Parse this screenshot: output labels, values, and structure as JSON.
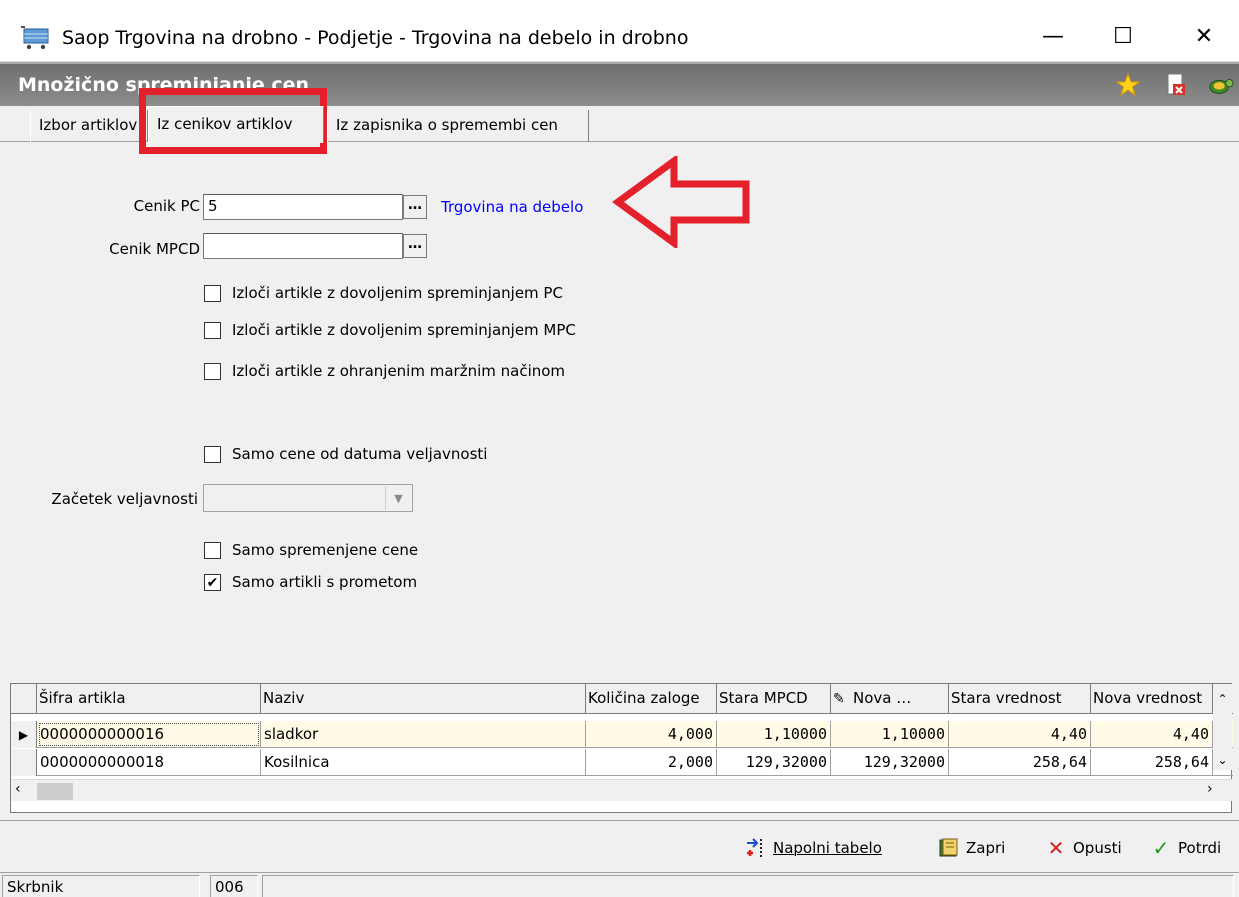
{
  "window": {
    "title": "Saop Trgovina na drobno - Podjetje - Trgovina na debelo in drobno",
    "minimize": "—",
    "maximize": "☐",
    "close": "✕"
  },
  "header": {
    "title": "Množično spreminjanje cen",
    "icons": [
      "star-icon",
      "document-delete-icon",
      "turtle-icon"
    ]
  },
  "tabs": [
    {
      "label": "Izbor artiklov",
      "active": false
    },
    {
      "label": "Iz cenikov artiklov",
      "active": true
    },
    {
      "label": "Iz zapisnika o spremembi cen",
      "active": false
    }
  ],
  "form": {
    "cenik_pc_label": "Cenik PC",
    "cenik_pc_value": "5",
    "cenik_pc_button": "…",
    "cenik_pc_desc": "Trgovina na debelo",
    "cenik_mpcd_label": "Cenik MPCD",
    "cenik_mpcd_value": "",
    "cenik_mpcd_button": "…",
    "chk_izloci_pc": "Izloči artikle z dovoljenim spreminjanjem PC",
    "chk_izloci_mpc": "Izloči artikle z dovoljenim spreminjanjem MPC",
    "chk_izloci_marzni": "Izloči artikle z ohranjenim maržnim načinom",
    "chk_samo_cene_datum": "Samo cene od datuma veljavnosti",
    "zacetek_label": "Začetek veljavnosti",
    "zacetek_value": "",
    "chk_samo_spremenjene": "Samo spremenjene cene",
    "chk_samo_promet": "Samo artikli s prometom",
    "checked": {
      "izloci_pc": false,
      "izloci_mpc": false,
      "izloci_marzni": false,
      "samo_cene_datum": false,
      "samo_spremenjene": false,
      "samo_promet": true
    }
  },
  "grid": {
    "columns": [
      "Šifra artikla",
      "Naziv",
      "Količina zaloge",
      "Stara MPCD",
      "Nova …",
      "Stara vrednost",
      "Nova vrednost"
    ],
    "rows": [
      {
        "sifra": "0000000000016",
        "naziv": "sladkor",
        "kolicina": "4,000",
        "stara_mpcd": "1,10000",
        "nova": "1,10000",
        "stara_vrednost": "4,40",
        "nova_vrednost": "4,40"
      },
      {
        "sifra": "0000000000018",
        "naziv": "Kosilnica",
        "kolicina": "2,000",
        "stara_mpcd": "129,32000",
        "nova": "129,32000",
        "stara_vrednost": "258,64",
        "nova_vrednost": "258,64"
      }
    ]
  },
  "actions": {
    "napolni": "Napolni tabelo",
    "zapri": "Zapri",
    "opusti": "Opusti",
    "potrdi": "Potrdi"
  },
  "status": {
    "user": "Skrbnik",
    "code": "006",
    "message": ""
  },
  "colors": {
    "link": "#0000ff",
    "annotation": "#e4202a",
    "selected_row": "#fffbe6"
  }
}
